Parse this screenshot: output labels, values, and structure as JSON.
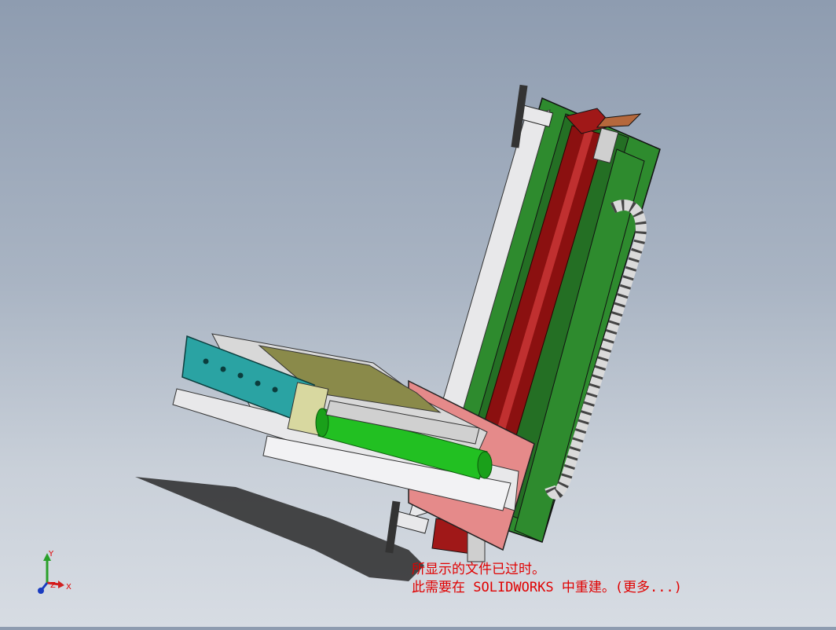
{
  "viewport": {
    "background_top": "#8e9cb0",
    "background_bottom": "#d7dce3",
    "model_colors": {
      "frame_green": "#2e8b2e",
      "screw_red": "#8b1010",
      "plate_pink": "#e58a8a",
      "profile_teal": "#2aa3a3",
      "cylinder_green": "#22c022",
      "aluminium": "#e8e8ea"
    }
  },
  "warning": {
    "line1": "所显示的文件已过时。",
    "line2": "此需要在 SOLIDWORKS 中重建。(更多...)"
  },
  "triad": {
    "x_label": "X",
    "y_label": "Y",
    "z_label": "Z"
  }
}
